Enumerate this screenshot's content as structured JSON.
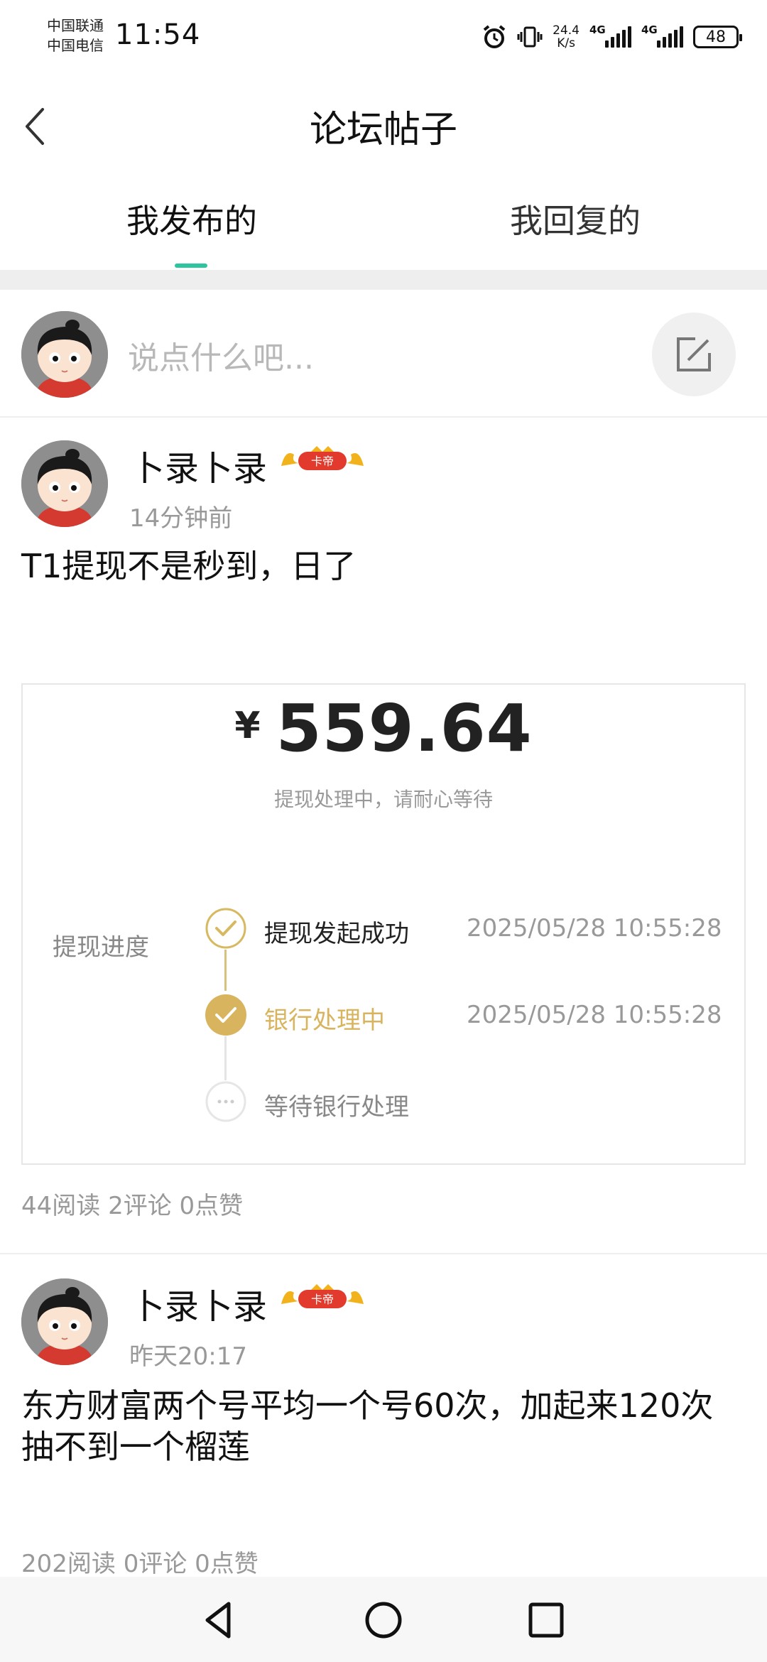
{
  "status_bar": {
    "carrier_1": "中国联通",
    "carrier_2": "中国电信",
    "time": "11:54",
    "net_speed_value": "24.4",
    "net_speed_unit": "K/s",
    "signal_1_label": "4G",
    "signal_2_label": "4G",
    "battery": "48",
    "icons": [
      "alarm-icon",
      "vibrate-icon",
      "signal-icon",
      "battery-icon"
    ]
  },
  "header": {
    "title": "论坛帖子",
    "back_icon": "chevron-left-icon"
  },
  "tabs": [
    {
      "label": "我发布的",
      "active": true
    },
    {
      "label": "我回复的",
      "active": false
    }
  ],
  "accent_color": "#2ec4a0",
  "compose": {
    "placeholder": "说点什么吧...",
    "edit_icon": "edit-icon"
  },
  "posts": [
    {
      "author": "卜录卜录",
      "badge": "卡帝",
      "time": "14分钟前",
      "content": "T1提现不是秒到，日了",
      "image": {
        "currency": "¥",
        "amount": "559.64",
        "subtitle": "提现处理中，请耐心等待",
        "progress_label": "提现进度",
        "steps": [
          {
            "label": "提现发起成功",
            "time": "2025/05/28 10:55:28",
            "state": "done"
          },
          {
            "label": "银行处理中",
            "time": "2025/05/28 10:55:28",
            "state": "current"
          },
          {
            "label": "等待银行处理",
            "time": "",
            "state": "pending"
          }
        ]
      },
      "stats": "44阅读 2评论 0点赞"
    },
    {
      "author": "卜录卜录",
      "badge": "卡帝",
      "time": "昨天20:17",
      "content": "东方财富两个号平均一个号60次，加起来120次抽不到一个榴莲",
      "stats": "202阅读 0评论 0点赞"
    }
  ],
  "system_nav": {
    "back_icon": "triangle-back-icon",
    "home_icon": "circle-home-icon",
    "recents_icon": "square-recents-icon"
  }
}
